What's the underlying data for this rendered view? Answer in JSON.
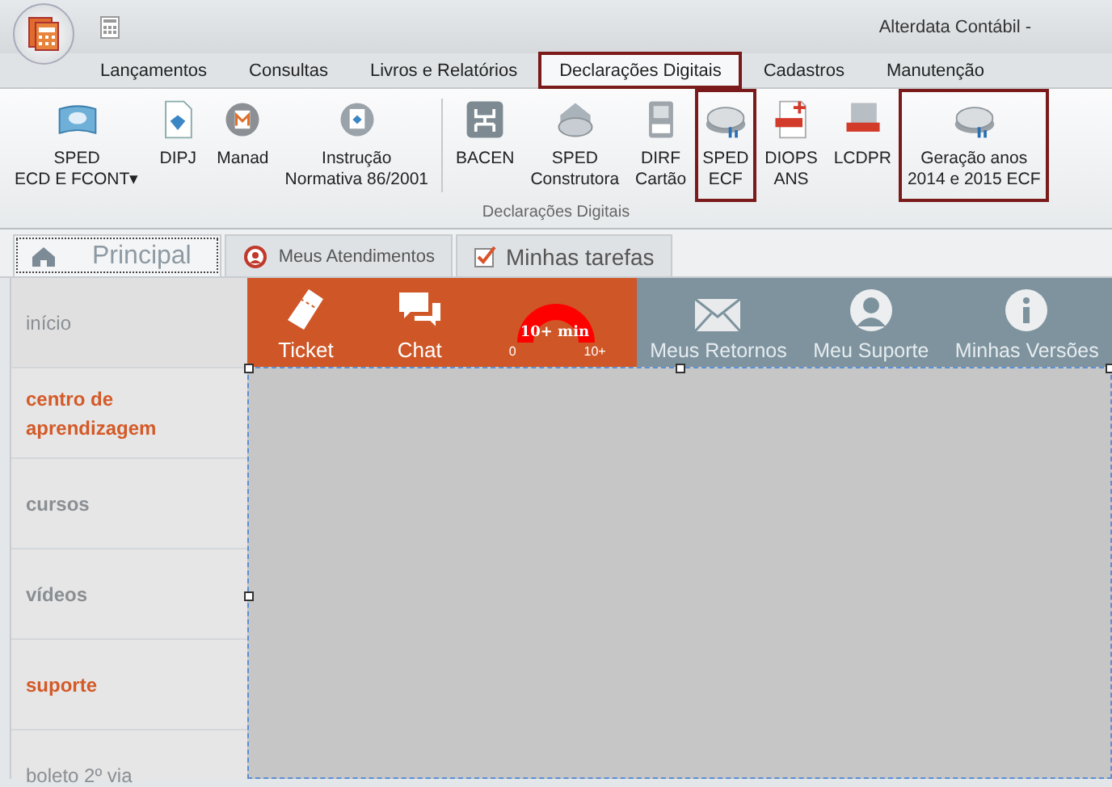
{
  "window": {
    "title": "Alterdata Contábil -"
  },
  "ribbon_tabs": [
    {
      "label": "Lançamentos",
      "selected": false,
      "highlighted": false
    },
    {
      "label": "Consultas",
      "selected": false,
      "highlighted": false
    },
    {
      "label": "Livros e Relatórios",
      "selected": false,
      "highlighted": false
    },
    {
      "label": "Declarações Digitais",
      "selected": true,
      "highlighted": true
    },
    {
      "label": "Cadastros",
      "selected": false,
      "highlighted": false
    },
    {
      "label": "Manutenção",
      "selected": false,
      "highlighted": false
    }
  ],
  "ribbon": {
    "group": "Declarações Digitais",
    "buttons": [
      {
        "lines": [
          "SPED",
          "ECD E FCONT"
        ],
        "caret": "▾",
        "highlighted": false
      },
      {
        "lines": [
          "DIPJ"
        ],
        "highlighted": false
      },
      {
        "lines": [
          "Manad"
        ],
        "highlighted": false
      },
      {
        "lines": [
          "Instrução",
          "Normativa 86/2001"
        ],
        "highlighted": false
      },
      {
        "lines": [
          "BACEN"
        ],
        "highlighted": false
      },
      {
        "lines": [
          "SPED",
          "Construtora"
        ],
        "highlighted": false
      },
      {
        "lines": [
          "DIRF",
          "Cartão"
        ],
        "highlighted": false
      },
      {
        "lines": [
          "SPED",
          "ECF"
        ],
        "highlighted": true
      },
      {
        "lines": [
          "DIOPS",
          "ANS"
        ],
        "highlighted": false
      },
      {
        "lines": [
          "LCDPR"
        ],
        "highlighted": false
      },
      {
        "lines": [
          "Geração anos",
          "2014 e 2015 ECF"
        ],
        "highlighted": true
      }
    ]
  },
  "page_tabs": [
    {
      "label": "Principal",
      "selected": true
    },
    {
      "label": "Meus Atendimentos",
      "selected": false
    },
    {
      "label": "Minhas tarefas",
      "selected": false
    }
  ],
  "sidebar": {
    "items": [
      {
        "label": "início",
        "kind": "header",
        "color": "#8a8f94"
      },
      {
        "label": "centro de aprendizagem",
        "kind": "bold",
        "color": "#d45a28"
      },
      {
        "label": "cursos",
        "kind": "bold",
        "color": "#8a8f94"
      },
      {
        "label": "vídeos",
        "kind": "bold",
        "color": "#8a8f94"
      },
      {
        "label": "suporte",
        "kind": "bold",
        "color": "#d45a28"
      },
      {
        "label": "boleto 2º via",
        "kind": "plain",
        "color": "#8a8f94"
      }
    ]
  },
  "toolbar": {
    "primary": [
      {
        "label": "Ticket"
      },
      {
        "label": "Chat"
      }
    ],
    "gauge": {
      "label": "10+ min",
      "min": "0",
      "max": "10+"
    },
    "secondary": [
      {
        "label": "Meus Retornos"
      },
      {
        "label": "Meu Suporte"
      },
      {
        "label": "Minhas Versões"
      }
    ]
  }
}
